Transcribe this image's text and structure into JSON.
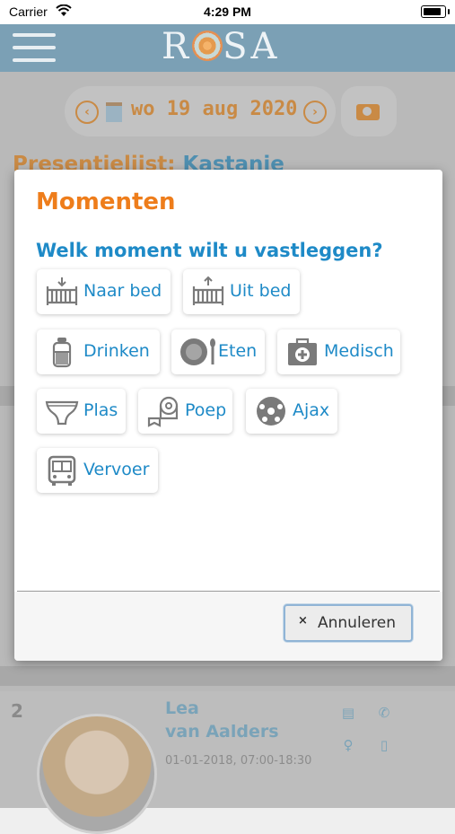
{
  "status_bar": {
    "carrier": "Carrier",
    "time": "4:29 PM"
  },
  "app": {
    "logo": "ROSA"
  },
  "date_nav": {
    "date": "wo 19 aug 2020"
  },
  "background": {
    "title_prefix": "Presentielijst:",
    "title_group": "Kastanje",
    "child": {
      "number": "2",
      "first_name": "Lea",
      "last_name": "van Aalders",
      "meta": "01-01-2018, 07:00-18:30"
    }
  },
  "modal": {
    "title": "Momenten",
    "question": "Welk moment wilt u vastleggen?",
    "moments": [
      {
        "label": "Naar bed",
        "icon": "crib-down-icon"
      },
      {
        "label": "Uit bed",
        "icon": "crib-up-icon"
      },
      {
        "label": "Drinken",
        "icon": "bottle-icon"
      },
      {
        "label": "Eten",
        "icon": "plate-icon"
      },
      {
        "label": "Medisch",
        "icon": "medical-kit-icon"
      },
      {
        "label": "Plas",
        "icon": "diaper-icon"
      },
      {
        "label": "Poep",
        "icon": "toilet-paper-icon"
      },
      {
        "label": "Ajax",
        "icon": "ball-icon"
      },
      {
        "label": "Vervoer",
        "icon": "bus-icon"
      }
    ],
    "cancel_icon": "×",
    "cancel_label": "Annuleren"
  },
  "colors": {
    "accent_orange": "#ee7d1b",
    "accent_blue": "#1e8ac7",
    "navbar": "#7ba0b5"
  }
}
